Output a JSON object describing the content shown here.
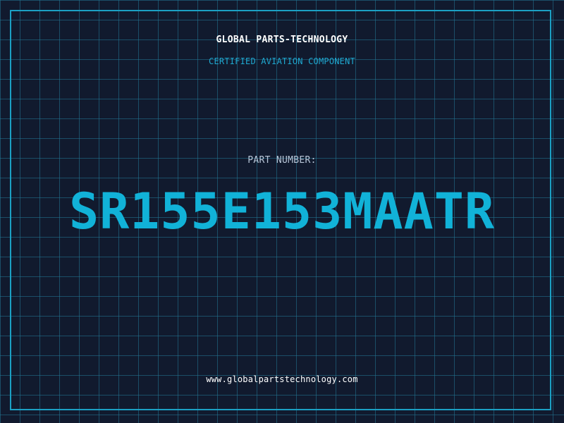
{
  "header": {
    "company": "GLOBAL PARTS-TECHNOLOGY",
    "subtitle": "CERTIFIED AVIATION COMPONENT"
  },
  "part": {
    "label": "PART NUMBER:",
    "number": "SR155E153MAATR"
  },
  "footer": {
    "website": "www.globalpartstechnology.com"
  },
  "colors": {
    "background": "#111a2e",
    "grid": "#2378a0",
    "accent": "#1ba0c4",
    "part_number": "#11b2d8"
  }
}
